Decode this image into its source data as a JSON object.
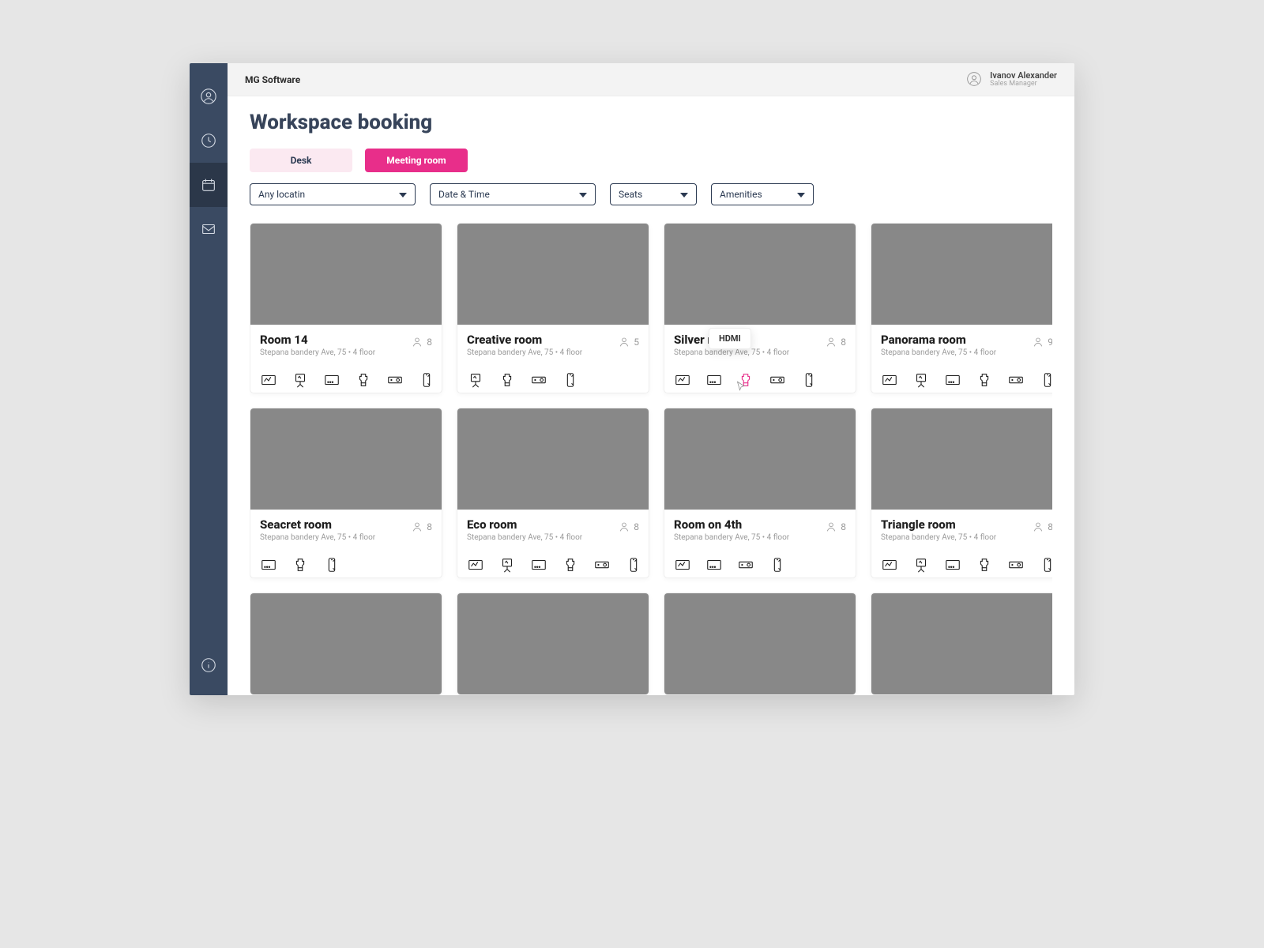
{
  "colors": {
    "accent": "#e82e8a",
    "navy": "#3a4a62",
    "title": "#37445a"
  },
  "sidebar": {
    "icons": [
      "user",
      "clock",
      "calendar",
      "mail"
    ],
    "bottom_icon": "info",
    "active_index": 2
  },
  "topbar": {
    "app_name": "MG Software",
    "user_name": "Ivanov Alexander",
    "user_role": "Sales Manager"
  },
  "page_title": "Workspace booking",
  "tabs": {
    "desk_label": "Desk",
    "meeting_label": "Meeting room",
    "active": "meeting"
  },
  "filters": {
    "location": "Any locatin",
    "datetime": "Date & Time",
    "seats": "Seats",
    "amenities": "Amenities"
  },
  "tooltip": {
    "label": "HDMI"
  },
  "address": "Stepana bandery Ave, 75   •   4 floor",
  "rooms": [
    {
      "name": "Room 14",
      "cap": 8,
      "amen": [
        "whiteboard",
        "flipchart",
        "tv",
        "hdmi",
        "projector",
        "phone"
      ]
    },
    {
      "name": "Creative room",
      "cap": 5,
      "amen": [
        "flipchart",
        "hdmi",
        "projector",
        "phone"
      ]
    },
    {
      "name": "Silver room",
      "cap": 8,
      "amen": [
        "whiteboard",
        "tv",
        "hdmi",
        "projector",
        "phone"
      ],
      "hot": "hdmi",
      "show_tooltip": true
    },
    {
      "name": "Panorama room",
      "cap": 9,
      "amen": [
        "whiteboard",
        "flipchart",
        "tv",
        "hdmi",
        "projector",
        "phone"
      ]
    },
    {
      "name": "Seacret room",
      "cap": 8,
      "amen": [
        "tv",
        "hdmi",
        "phone"
      ]
    },
    {
      "name": "Eco room",
      "cap": 8,
      "amen": [
        "whiteboard",
        "flipchart",
        "tv",
        "hdmi",
        "projector",
        "phone"
      ]
    },
    {
      "name": "Room on 4th",
      "cap": 8,
      "amen": [
        "whiteboard",
        "tv",
        "projector",
        "phone"
      ]
    },
    {
      "name": "Triangle room",
      "cap": 8,
      "amen": [
        "whiteboard",
        "flipchart",
        "tv",
        "hdmi",
        "projector",
        "phone"
      ]
    },
    {
      "name": "",
      "cap": "",
      "amen": []
    },
    {
      "name": "",
      "cap": "",
      "amen": []
    },
    {
      "name": "",
      "cap": "",
      "amen": []
    },
    {
      "name": "",
      "cap": "",
      "amen": []
    }
  ]
}
